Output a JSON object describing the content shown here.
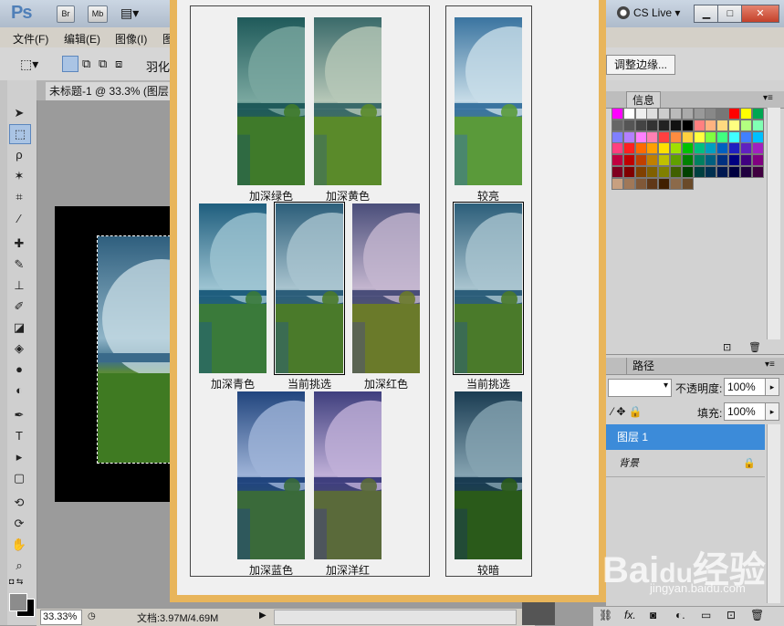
{
  "app": {
    "logo": "Ps",
    "bridge_label": "Br",
    "minibridge_label": "Mb",
    "cs_live": "CS Live"
  },
  "menubar": {
    "items": [
      "文件(F)",
      "编辑(E)",
      "图像(I)",
      "图"
    ]
  },
  "options_bar": {
    "feather_label": "羽化",
    "refine_edge_label": "调整边缘..."
  },
  "document": {
    "tab_title": "未标题-1 @ 33.3% (图层"
  },
  "status_bar": {
    "zoom": "33.33%",
    "doc_size": "文档:3.97M/4.69M"
  },
  "panels": {
    "top_tab": "信息",
    "bottom_tab": "路径",
    "opacity_label": "不透明度:",
    "opacity_value": "100%",
    "fill_label": "填充:",
    "fill_value": "100%",
    "layers": [
      {
        "name": "图层 1",
        "selected": true
      },
      {
        "name": "背景",
        "selected": false
      }
    ]
  },
  "variations": {
    "labels": {
      "more_green": "加深绿色",
      "more_yellow": "加深黄色",
      "more_cyan": "加深青色",
      "current_pick": "当前挑选",
      "more_red": "加深红色",
      "more_blue": "加深蓝色",
      "more_magenta": "加深洋红",
      "lighter": "较亮",
      "current_pick_2": "当前挑选",
      "darker": "较暗"
    }
  },
  "swatches": {
    "colors": [
      "#ff00ff",
      "#ffffff",
      "#eeeeee",
      "#dddddd",
      "#cccccc",
      "#bbbbbb",
      "#aaaaaa",
      "#999999",
      "#888888",
      "#777777",
      "#ff0000",
      "#ffff00",
      "#00a651",
      "#666666",
      "#555555",
      "#444444",
      "#333333",
      "#222222",
      "#111111",
      "#000000",
      "#ff8080",
      "#ffb380",
      "#ffd980",
      "#ffff80",
      "#b3ff80",
      "#80ffb3",
      "#8080ff",
      "#b380ff",
      "#ff80ff",
      "#ff80b3",
      "#ff4040",
      "#ff8c40",
      "#ffd040",
      "#ffff40",
      "#80ff40",
      "#40ff80",
      "#40ffff",
      "#4080ff",
      "#00bfff",
      "#ff4080",
      "#ff2020",
      "#ff6a00",
      "#ffa000",
      "#ffe000",
      "#a0e000",
      "#00c000",
      "#00c080",
      "#00a0c0",
      "#0060c0",
      "#2020c0",
      "#6020c0",
      "#a020c0",
      "#c00040",
      "#c00000",
      "#c04000",
      "#c08000",
      "#c0c000",
      "#60a000",
      "#008000",
      "#008060",
      "#006080",
      "#003080",
      "#000080",
      "#400080",
      "#800080",
      "#800020",
      "#800000",
      "#804000",
      "#806000",
      "#808000",
      "#406000",
      "#004000",
      "#004040",
      "#003050",
      "#001850",
      "#000040",
      "#200040",
      "#400040",
      "#c8a080",
      "#a07858",
      "#805838",
      "#603818",
      "#402000",
      "#8c6a4a",
      "#6a4a2a"
    ]
  }
}
